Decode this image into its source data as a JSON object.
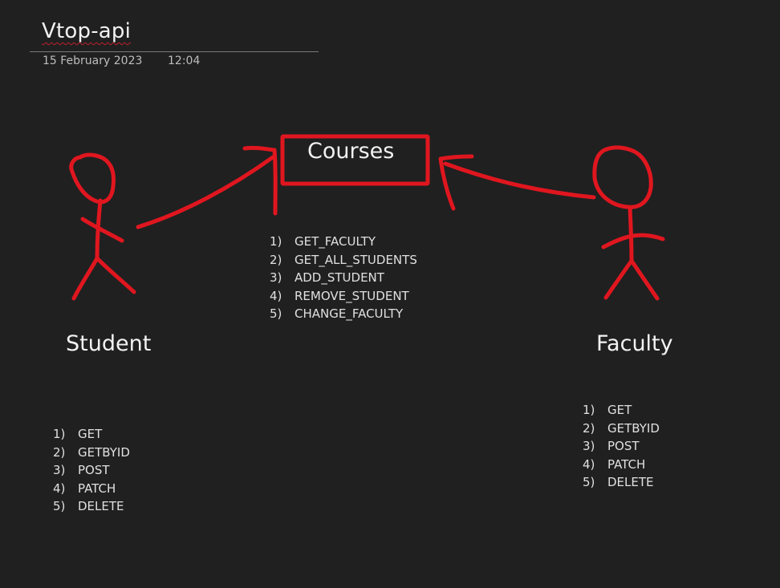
{
  "page": {
    "title": "Vtop-api",
    "date": "15 February 2023",
    "time": "12:04"
  },
  "diagram": {
    "ink_color": "#e0161f",
    "courses": {
      "label": "Courses",
      "items": [
        {
          "num": "1)",
          "text": "GET_FACULTY"
        },
        {
          "num": "2)",
          "text": "GET_ALL_STUDENTS"
        },
        {
          "num": "3)",
          "text": "ADD_STUDENT"
        },
        {
          "num": "4)",
          "text": "REMOVE_STUDENT"
        },
        {
          "num": "5)",
          "text": "CHANGE_FACULTY"
        }
      ]
    },
    "student": {
      "label": "Student",
      "items": [
        {
          "num": "1)",
          "text": "GET"
        },
        {
          "num": "2)",
          "text": "GETBYID"
        },
        {
          "num": "3)",
          "text": "POST"
        },
        {
          "num": "4)",
          "text": "PATCH"
        },
        {
          "num": "5)",
          "text": "DELETE"
        }
      ]
    },
    "faculty": {
      "label": "Faculty",
      "items": [
        {
          "num": "1)",
          "text": "GET"
        },
        {
          "num": "2)",
          "text": "GETBYID"
        },
        {
          "num": "3)",
          "text": "POST"
        },
        {
          "num": "4)",
          "text": "PATCH"
        },
        {
          "num": "5)",
          "text": "DELETE"
        }
      ]
    }
  }
}
